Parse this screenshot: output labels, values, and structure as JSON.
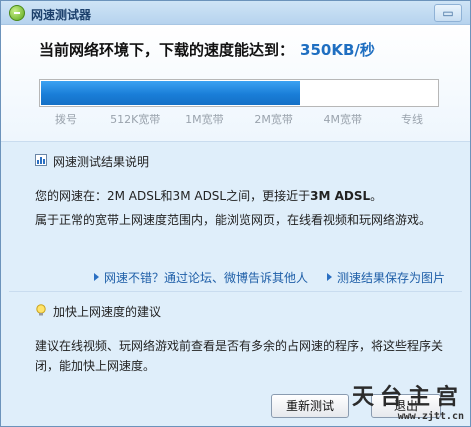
{
  "window": {
    "title": "网速测试器",
    "close_glyph": "▭"
  },
  "speed": {
    "headline": "当前网络环境下，下载的速度能达到：",
    "value": "350KB/秒",
    "bar_fill_fraction": 0.65,
    "ticks": [
      "拨号",
      "512K宽带",
      "1M宽带",
      "2M宽带",
      "4M宽带",
      "专线"
    ]
  },
  "results": {
    "heading": "网速测试结果说明",
    "line1_prefix": "您的网速在：2M ADSL和3M ADSL之间，更接近于",
    "line1_bold": "3M ADSL",
    "line1_suffix": "。",
    "line2": "属于正常的宽带上网速度范围内，能浏览网页，在线看视频和玩网络游戏。",
    "link_share": "网速不错？通过论坛、微博告诉其他人",
    "link_save": "测速结果保存为图片"
  },
  "advice": {
    "heading": "加快上网速度的建议",
    "line1": "建议在线视频、玩网络游戏前查看是否有多余的占网速的程序，将这些程序关",
    "line2": "闭，能加快上网速度。"
  },
  "buttons": {
    "retest": "重新测试",
    "exit": "退出"
  },
  "watermark": {
    "title": "天台主宫",
    "url": "www.zjtt.cn"
  },
  "colors": {
    "accent": "#1f6fc1",
    "bar": "#1a7ed8",
    "link": "#1f5fa8"
  }
}
